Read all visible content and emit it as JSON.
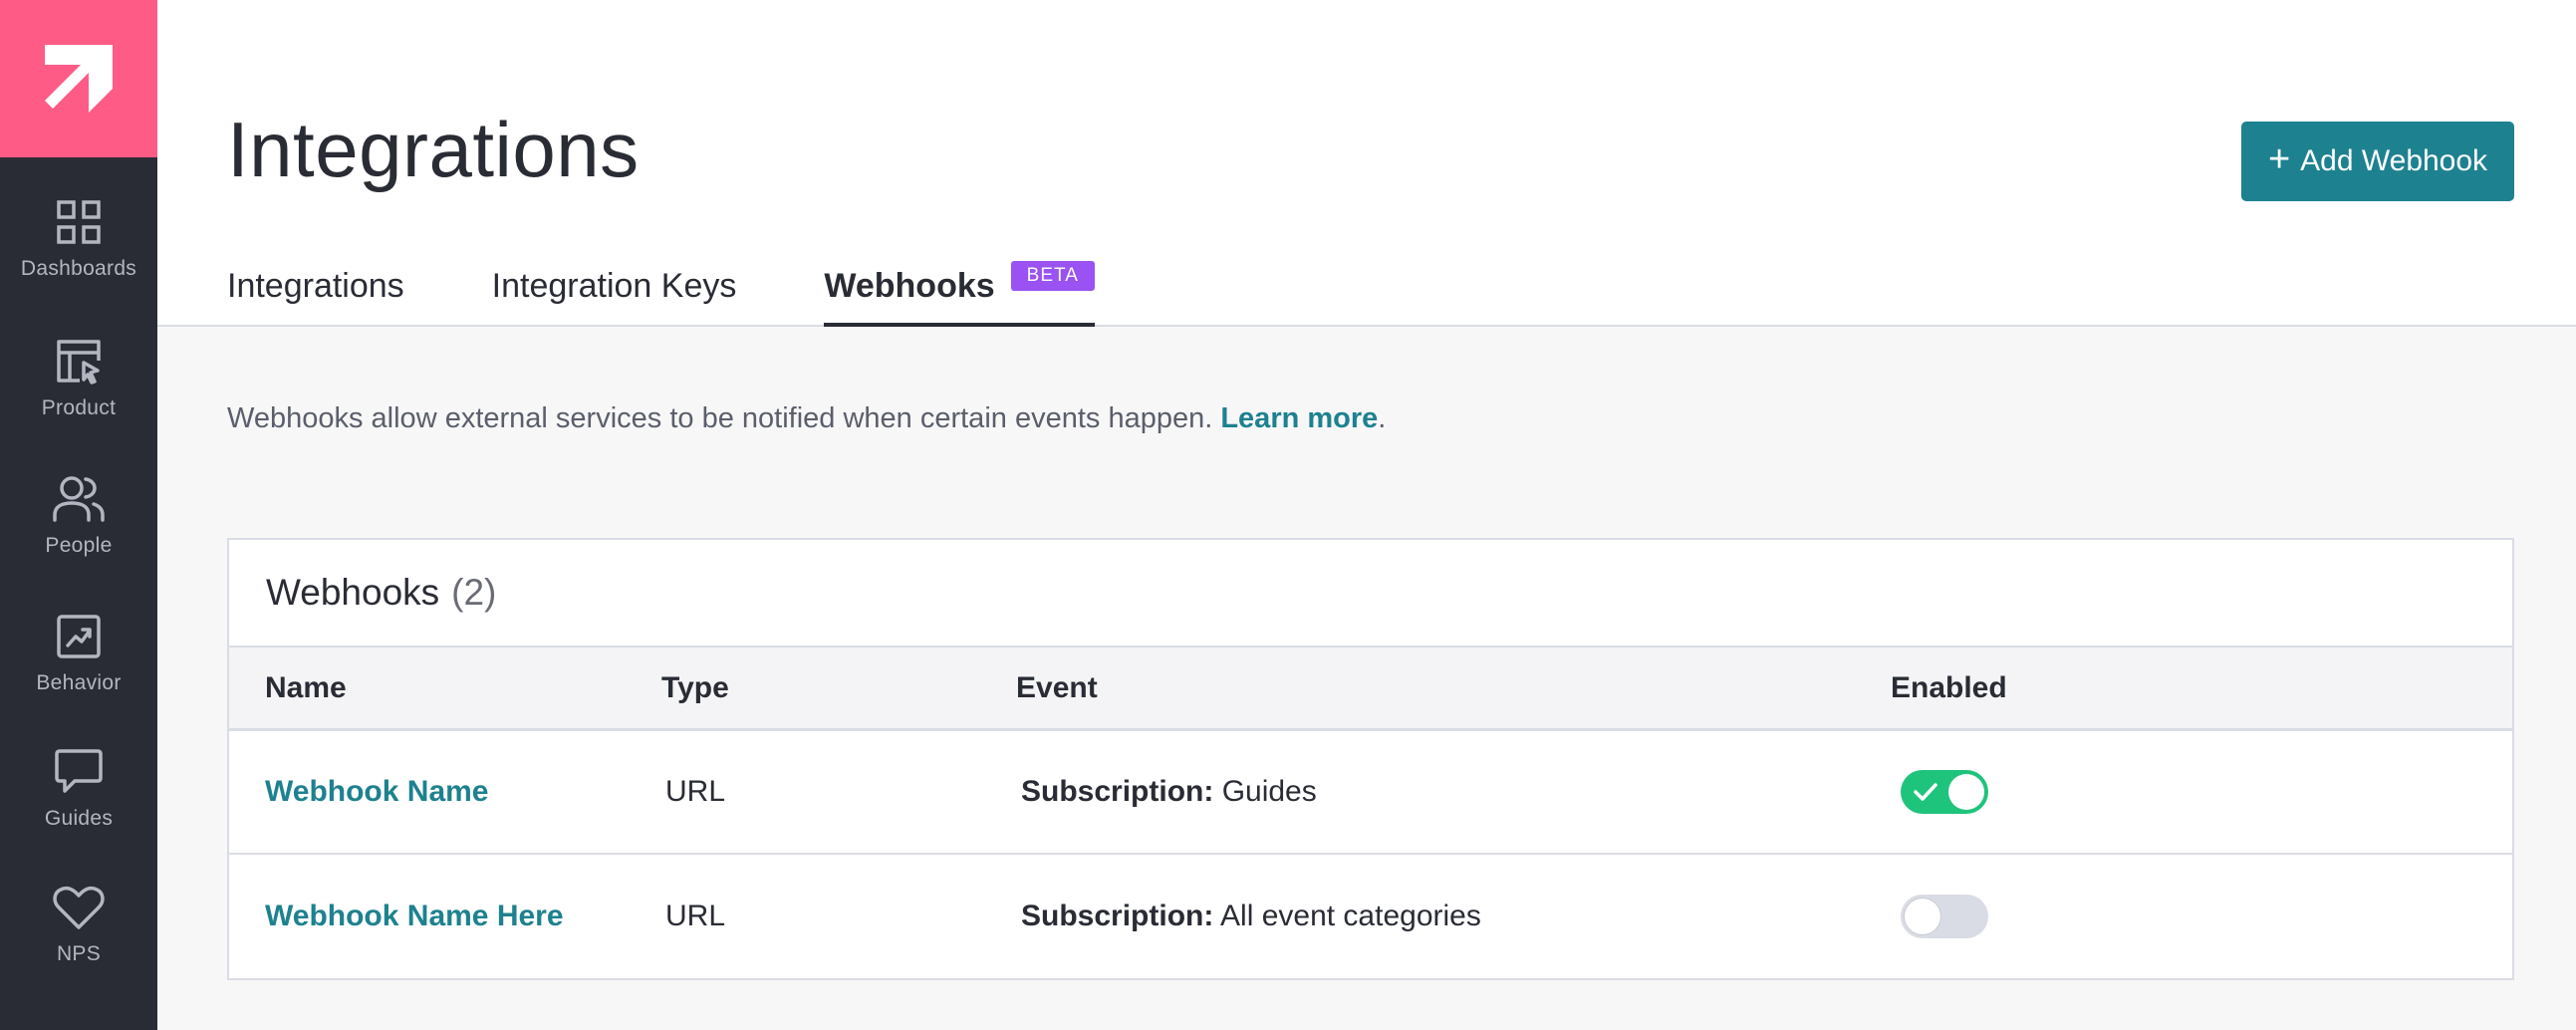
{
  "sidebar": {
    "items": [
      {
        "label": "Dashboards",
        "icon": "dashboard-grid-icon"
      },
      {
        "label": "Product",
        "icon": "product-layout-icon"
      },
      {
        "label": "People",
        "icon": "people-icon"
      },
      {
        "label": "Behavior",
        "icon": "behavior-chart-icon"
      },
      {
        "label": "Guides",
        "icon": "chat-bubble-icon"
      },
      {
        "label": "NPS",
        "icon": "heart-icon"
      }
    ]
  },
  "header": {
    "title": "Integrations",
    "add_button_label": "Add Webhook",
    "tabs": [
      {
        "label": "Integrations"
      },
      {
        "label": "Integration Keys"
      },
      {
        "label": "Webhooks",
        "badge": "BETA"
      }
    ]
  },
  "description": {
    "text": "Webhooks allow external services to be notified when certain events happen.",
    "link": "Learn more",
    "suffix": "."
  },
  "panel": {
    "title": "Webhooks",
    "count": "(2)",
    "columns": {
      "name": "Name",
      "type": "Type",
      "event": "Event",
      "enabled": "Enabled"
    },
    "rows": [
      {
        "name": "Webhook Name",
        "type": "URL",
        "event_label": "Subscription:",
        "event_value": "Guides",
        "enabled": true
      },
      {
        "name": "Webhook Name Here",
        "type": "URL",
        "event_label": "Subscription:",
        "event_value": "All event categories",
        "enabled": false
      }
    ]
  },
  "colors": {
    "brand_pink": "#fe5b86",
    "teal": "#1e818f",
    "beta_purple": "#9a52f2",
    "toggle_on": "#1fc47c",
    "sidebar_bg": "#2a2c35"
  }
}
